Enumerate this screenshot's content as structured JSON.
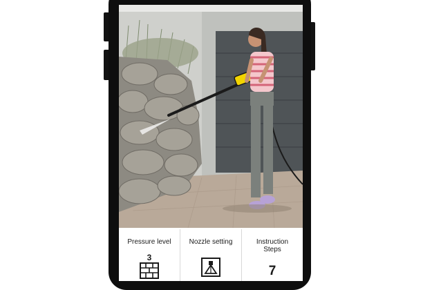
{
  "info_cards": [
    {
      "label": "Pressure level",
      "value": "3",
      "icon": "brick-wall-icon"
    },
    {
      "label": "Nozzle setting",
      "icon": "spray-nozzle-icon"
    },
    {
      "label": "Instruction\nSteps",
      "value": "7"
    }
  ],
  "photo": {
    "icon": "pressure-washer-photo"
  },
  "colors": {
    "frame": "#0e0e0e",
    "accent": "#f2d400",
    "divider": "#d8d8d8"
  }
}
